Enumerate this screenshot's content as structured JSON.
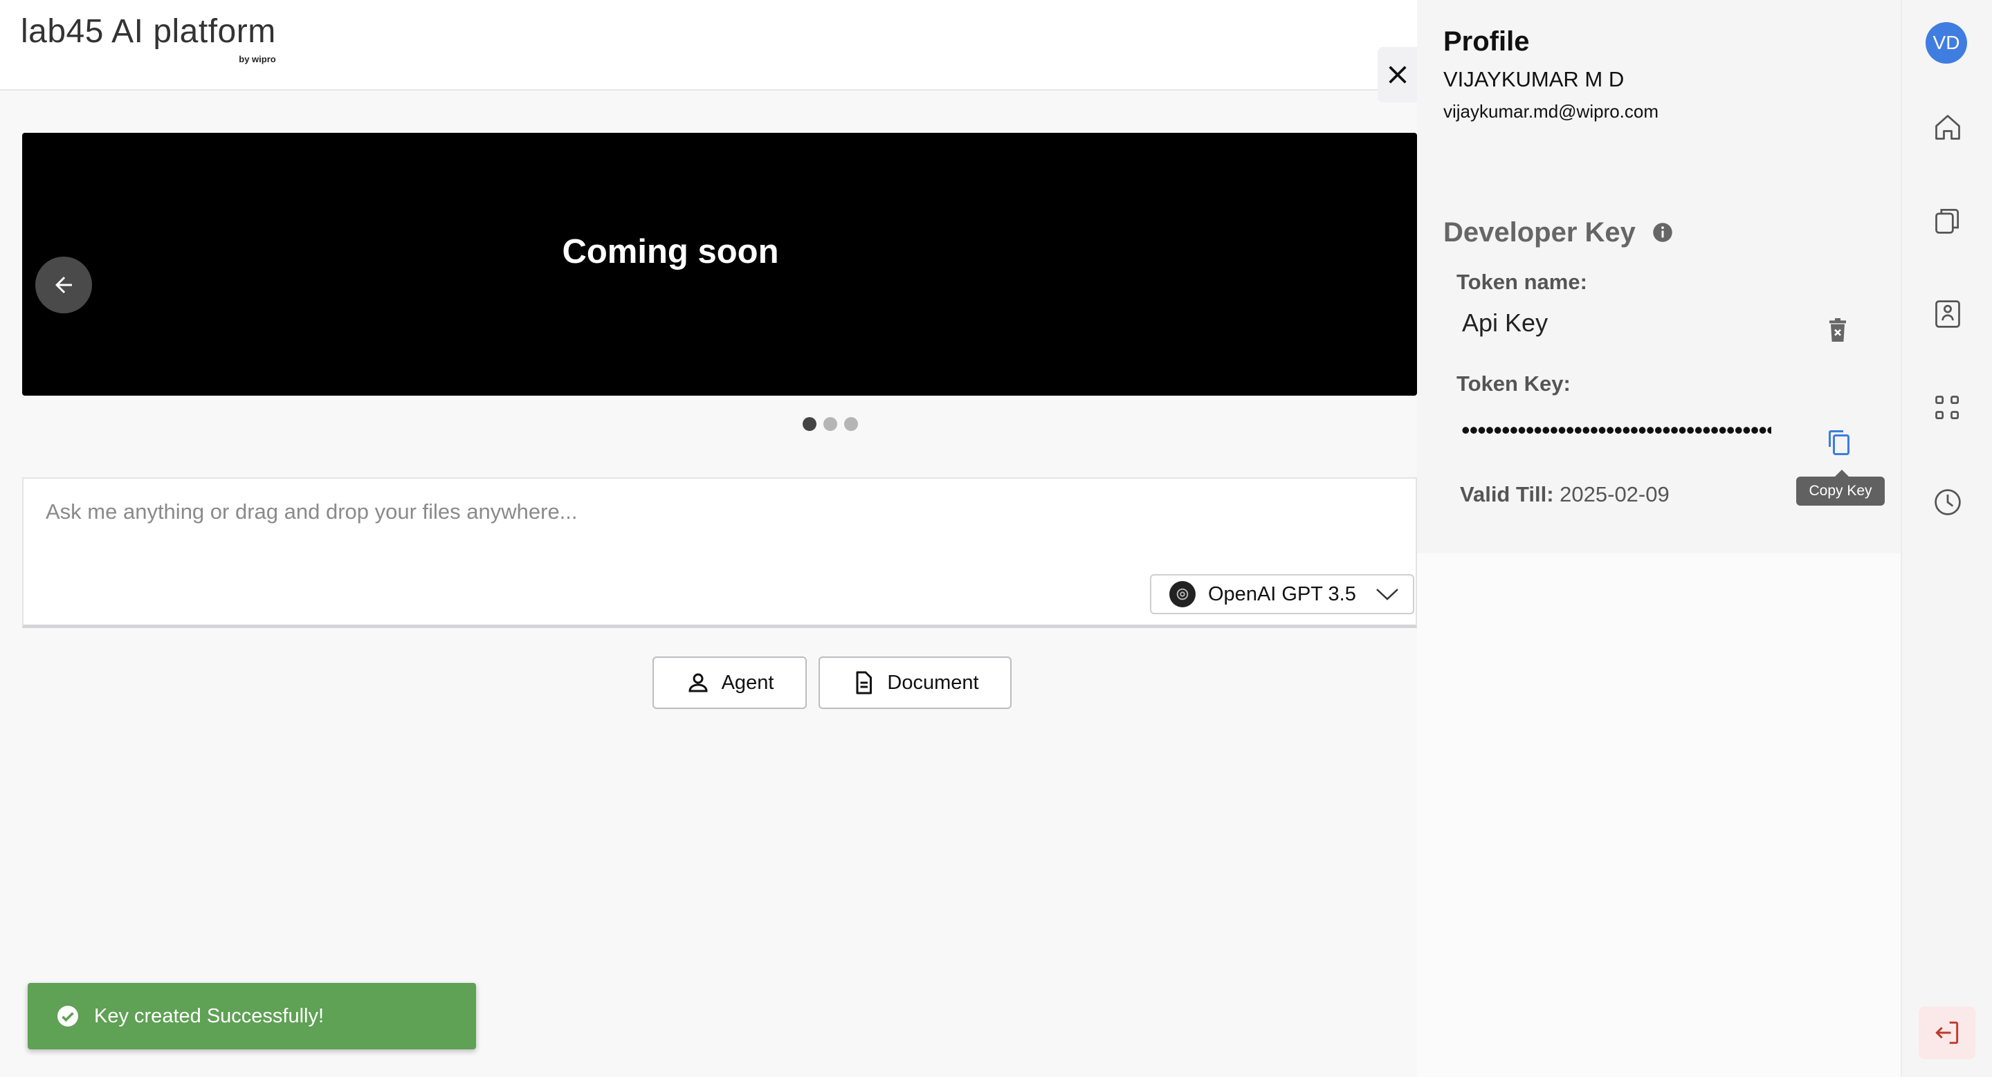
{
  "header": {
    "logo_text": "lab45 AI platform",
    "logo_sub": "by wipro"
  },
  "banner": {
    "title": "Coming soon",
    "slides": 3,
    "active_slide": 1
  },
  "prompt": {
    "placeholder": "Ask me anything or drag and drop your files anywhere...",
    "value": "",
    "model": "OpenAI GPT 3.5"
  },
  "chips": {
    "agent": "Agent",
    "document": "Document"
  },
  "toast": {
    "message": "Key created Successfully!"
  },
  "profile": {
    "title": "Profile",
    "name": "VIJAYKUMAR M D",
    "email": "vijaykumar.md@wipro.com",
    "developer_key_title": "Developer Key",
    "token_name_label": "Token name:",
    "token_name": "Api Key",
    "token_key_label": "Token Key:",
    "token_key_masked": "••••••••••••••••••••••••••••••••••••••••••••••••••••••",
    "copy_tooltip": "Copy Key",
    "valid_till_label": "Valid Till:",
    "valid_till": "2025-02-09"
  },
  "rail": {
    "avatar_initials": "VD"
  },
  "colors": {
    "toast_green": "#5fa155",
    "avatar_blue": "#3f7de0",
    "copy_blue": "#3b7ddd",
    "logout_red": "#c0392b"
  },
  "icons": [
    "close-icon",
    "arrow-left-icon",
    "chevron-down-icon",
    "person-icon",
    "document-icon",
    "check-circle-icon",
    "info-icon",
    "trash-icon",
    "copy-icon",
    "home-icon",
    "files-icon",
    "badge-icon",
    "apps-icon",
    "clock-icon",
    "logout-icon"
  ]
}
